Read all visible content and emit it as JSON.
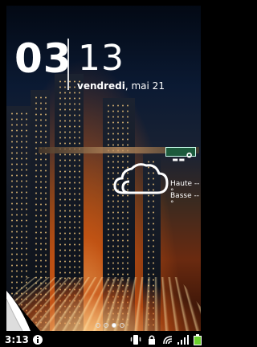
{
  "clock": {
    "hours": "03",
    "minutes": "13",
    "weekday": "vendredi",
    "date_rest": ", mai 21"
  },
  "weather": {
    "temp": "--°",
    "high": "Haute --°",
    "low": "Basse --°",
    "icon": "cloud-icon"
  },
  "pager": {
    "count": 4,
    "active_index": 2
  },
  "status_bar": {
    "time": "3:13",
    "icons": [
      "info-icon",
      "vibrate-icon",
      "lock-icon",
      "wifi-icon",
      "signal-icon",
      "battery-icon"
    ],
    "battery_color": "#6cd02c"
  },
  "wallpaper": {
    "description": "city-highway-night-light-trails"
  }
}
